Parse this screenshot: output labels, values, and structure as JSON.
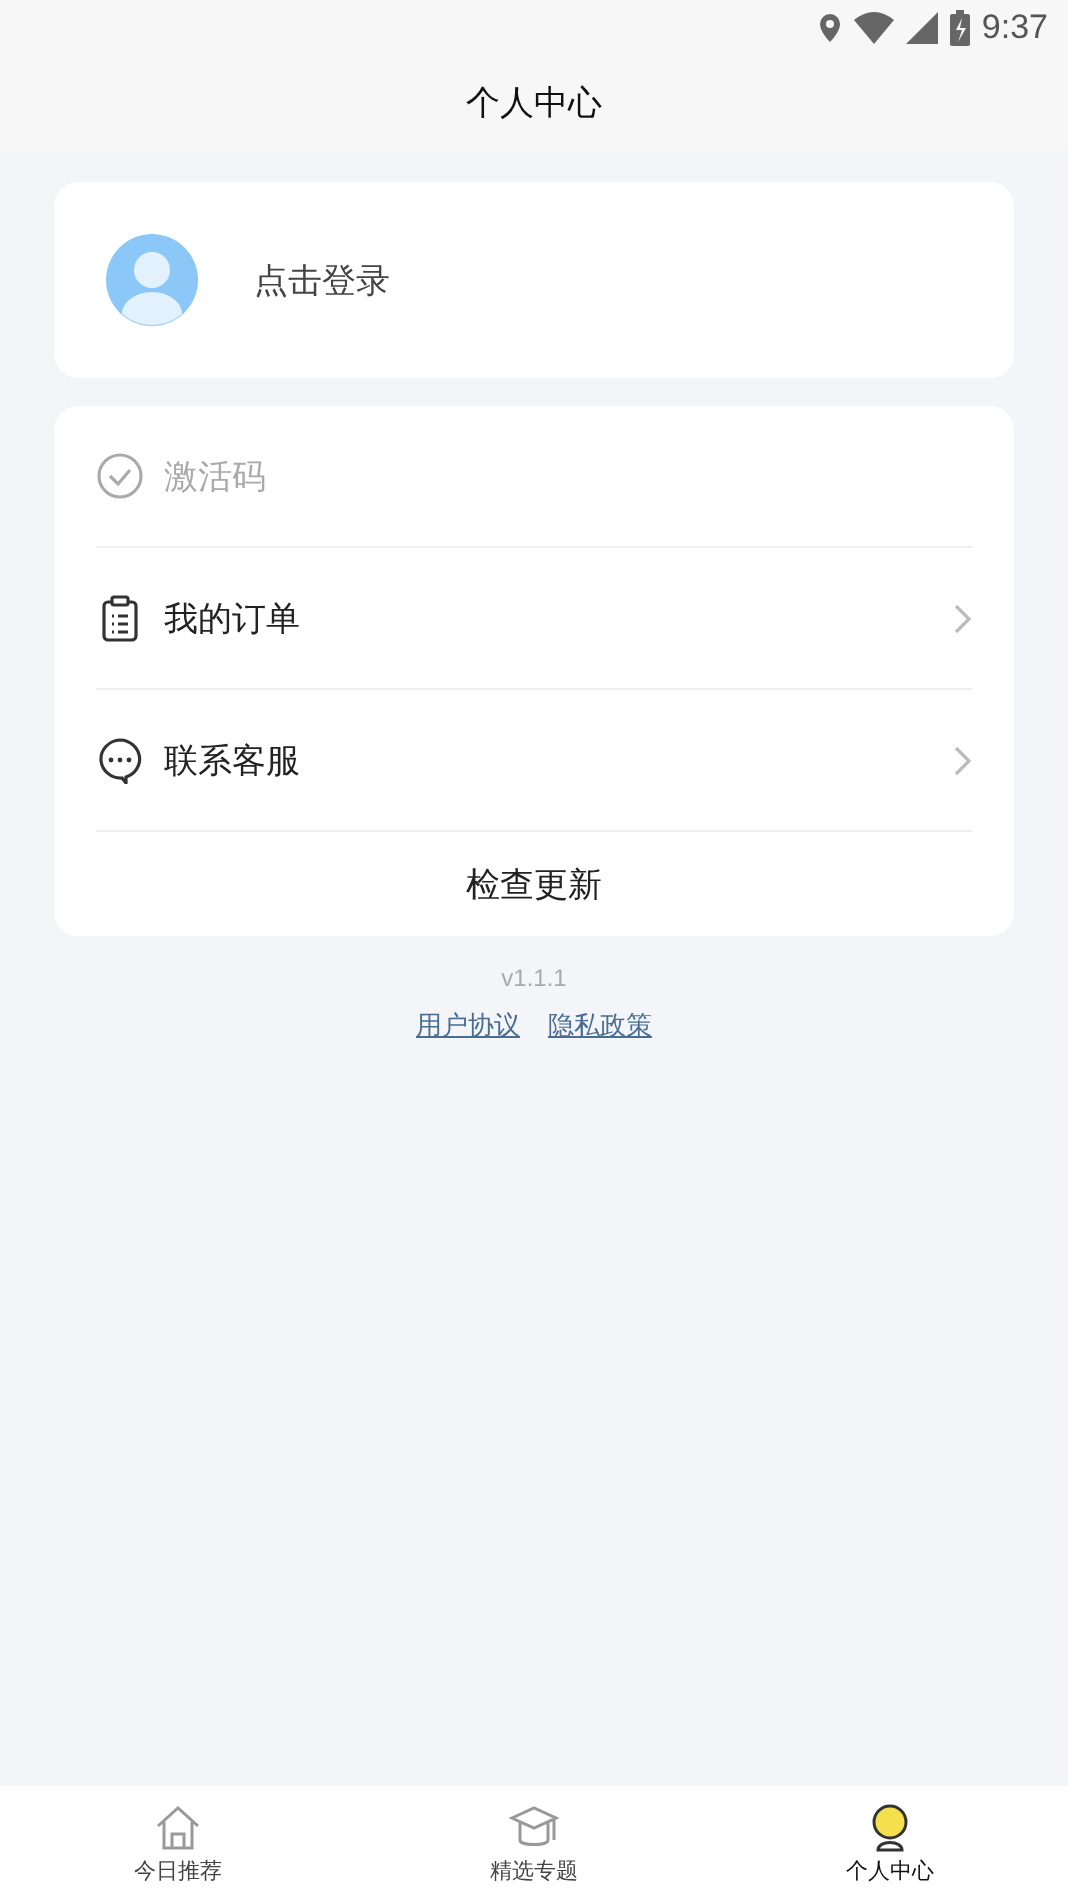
{
  "status_bar": {
    "time": "9:37"
  },
  "header": {
    "title": "个人中心"
  },
  "profile": {
    "login_text": "点击登录"
  },
  "menu": [
    {
      "kind": "check",
      "label": "激活码",
      "disabled": true
    },
    {
      "kind": "orders",
      "label": "我的订单",
      "disabled": false
    },
    {
      "kind": "service",
      "label": "联系客服",
      "disabled": false
    },
    {
      "kind": "update",
      "label": "检查更新"
    }
  ],
  "version": "v1.1.1",
  "links": [
    "用户协议",
    "隐私政策"
  ],
  "tabs": [
    {
      "kind": "home",
      "label": "今日推荐",
      "selected": false
    },
    {
      "kind": "topics",
      "label": "精选专题",
      "selected": false
    },
    {
      "kind": "profile",
      "label": "个人中心",
      "selected": true
    }
  ]
}
